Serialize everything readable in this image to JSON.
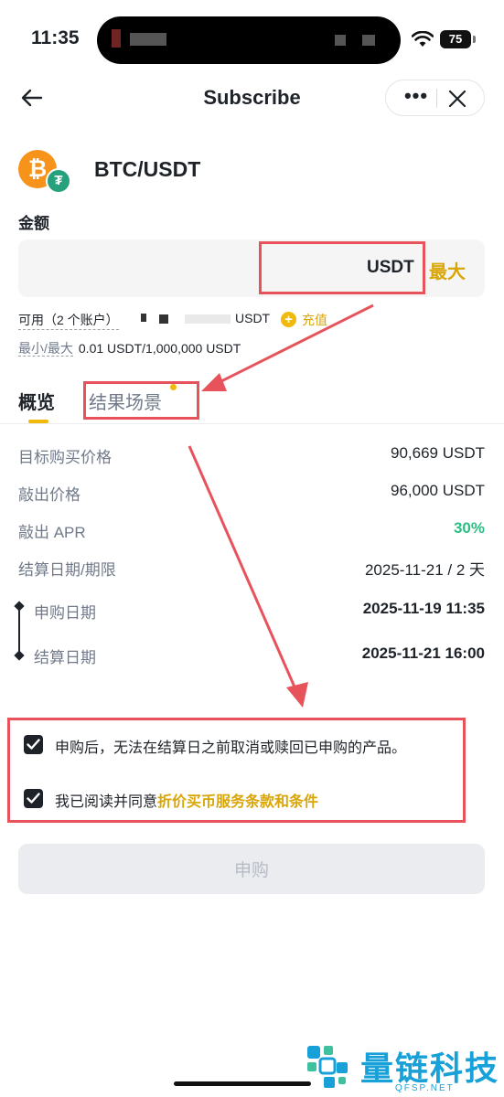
{
  "status_bar": {
    "time": "11:35",
    "battery": "75"
  },
  "nav": {
    "title": "Subscribe"
  },
  "pair": {
    "name": "BTC/USDT",
    "base_icon": "bitcoin-icon",
    "quote_icon": "tether-icon"
  },
  "amount": {
    "label": "金额",
    "value": "",
    "unit": "USDT",
    "max_label": "最大"
  },
  "available": {
    "label": "可用（2 个账户）",
    "unit": "USDT",
    "deposit_label": "充值"
  },
  "limits": {
    "label": "最小/最大",
    "value": "0.01 USDT/1,000,000 USDT"
  },
  "tabs": [
    {
      "label": "概览",
      "active": true
    },
    {
      "label": "结果场景",
      "active": false
    }
  ],
  "details": [
    {
      "label": "目标购买价格",
      "value": "90,669 USDT"
    },
    {
      "label": "敲出价格",
      "value": "96,000 USDT"
    },
    {
      "label": "敲出 APR",
      "value": "30%"
    },
    {
      "label": "结算日期/期限",
      "value": "2025-11-21 / 2 天"
    }
  ],
  "timeline": [
    {
      "label": "申购日期",
      "value": "2025-11-19 11:35"
    },
    {
      "label": "结算日期",
      "value": "2025-11-21 16:00"
    }
  ],
  "terms": {
    "notice": "申购后，无法在结算日之前取消或赎回已申购的产品。",
    "agree_prefix": "我已阅读并同意",
    "agree_link": "折价买币服务条款和条件"
  },
  "submit_label": "申购",
  "watermark": {
    "title": "量链科技",
    "subtitle": "QFSP.NET"
  },
  "colors": {
    "accent": "#f0b90b",
    "link": "#d9a507",
    "positive": "#2ebd85",
    "annotation": "#e8535b"
  }
}
